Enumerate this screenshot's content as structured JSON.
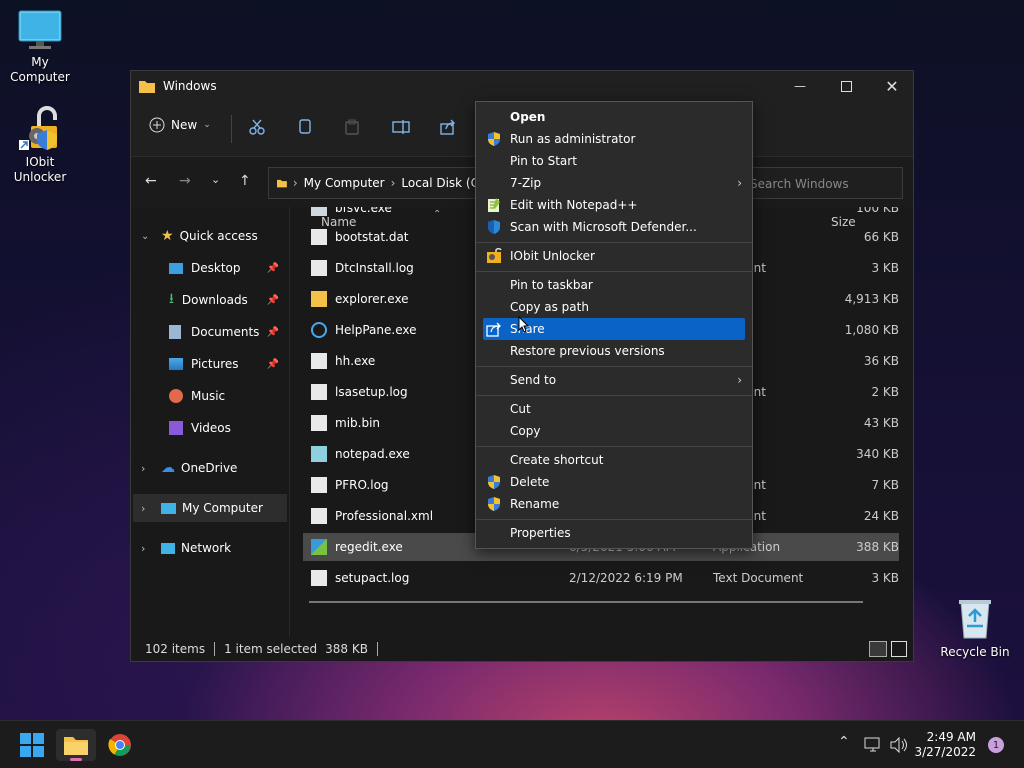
{
  "desktop": {
    "icons": [
      {
        "label": "My Computer"
      },
      {
        "label": "IObit Unlocker"
      },
      {
        "label": "Recycle Bin"
      }
    ]
  },
  "window": {
    "title": "Windows",
    "toolbar": {
      "new_label": "New"
    },
    "address": {
      "parts": [
        "My Computer",
        "Local Disk (C"
      ]
    },
    "search": {
      "placeholder": "Search Windows"
    },
    "columns": {
      "name": "Name",
      "size": "Size"
    },
    "sidebar": {
      "quick_access": "Quick access",
      "items": [
        {
          "label": "Desktop",
          "pinned": true
        },
        {
          "label": "Downloads",
          "pinned": true
        },
        {
          "label": "Documents",
          "pinned": true
        },
        {
          "label": "Pictures",
          "pinned": true
        },
        {
          "label": "Music",
          "pinned": false
        },
        {
          "label": "Videos",
          "pinned": false
        }
      ],
      "onedrive": "OneDrive",
      "my_computer": "My Computer",
      "network": "Network"
    },
    "files": [
      {
        "name": "bfsvc.exe",
        "date": "",
        "type": "ation",
        "size": "100 KB"
      },
      {
        "name": "bootstat.dat",
        "date": "",
        "type": "e",
        "size": "66 KB"
      },
      {
        "name": "DtcInstall.log",
        "date": "",
        "type": "ocument",
        "size": "3 KB"
      },
      {
        "name": "explorer.exe",
        "date": "",
        "type": "ation",
        "size": "4,913 KB"
      },
      {
        "name": "HelpPane.exe",
        "date": "",
        "type": "ation",
        "size": "1,080 KB"
      },
      {
        "name": "hh.exe",
        "date": "",
        "type": "ation",
        "size": "36 KB"
      },
      {
        "name": "lsasetup.log",
        "date": "",
        "type": "ocument",
        "size": "2 KB"
      },
      {
        "name": "mib.bin",
        "date": "",
        "type": "",
        "size": "43 KB"
      },
      {
        "name": "notepad.exe",
        "date": "",
        "type": "ation",
        "size": "340 KB"
      },
      {
        "name": "PFRO.log",
        "date": "",
        "type": "ocument",
        "size": "7 KB"
      },
      {
        "name": "Professional.xml",
        "date": "",
        "type": "ocument",
        "size": "24 KB"
      },
      {
        "name": "regedit.exe",
        "date": "6/5/2021 5:06 AM",
        "type": "Application",
        "size": "388 KB"
      },
      {
        "name": "setupact.log",
        "date": "2/12/2022 6:19 PM",
        "type": "Text Document",
        "size": "3 KB"
      }
    ],
    "status": {
      "items": "102 items",
      "selected": "1 item selected",
      "size": "388 KB"
    }
  },
  "context_menu": {
    "items": [
      {
        "label": "Open",
        "bold": true
      },
      {
        "label": "Run as administrator"
      },
      {
        "label": "Pin to Start"
      },
      {
        "label": "7-Zip",
        "submenu": true
      },
      {
        "label": "Edit with Notepad++"
      },
      {
        "label": "Scan with Microsoft Defender..."
      },
      {
        "label": "IObit Unlocker"
      },
      {
        "label": "Pin to taskbar"
      },
      {
        "label": "Copy as path"
      },
      {
        "label": "Share",
        "highlighted": true
      },
      {
        "label": "Restore previous versions"
      },
      {
        "label": "Send to",
        "submenu": true
      },
      {
        "label": "Cut"
      },
      {
        "label": "Copy"
      },
      {
        "label": "Create shortcut"
      },
      {
        "label": "Delete"
      },
      {
        "label": "Rename"
      },
      {
        "label": "Properties"
      }
    ]
  },
  "taskbar": {
    "time": "2:49 AM",
    "date": "3/27/2022",
    "notification_count": "1"
  },
  "colors": {
    "accent": "#0a64c8",
    "folder": "#f5c04a"
  }
}
